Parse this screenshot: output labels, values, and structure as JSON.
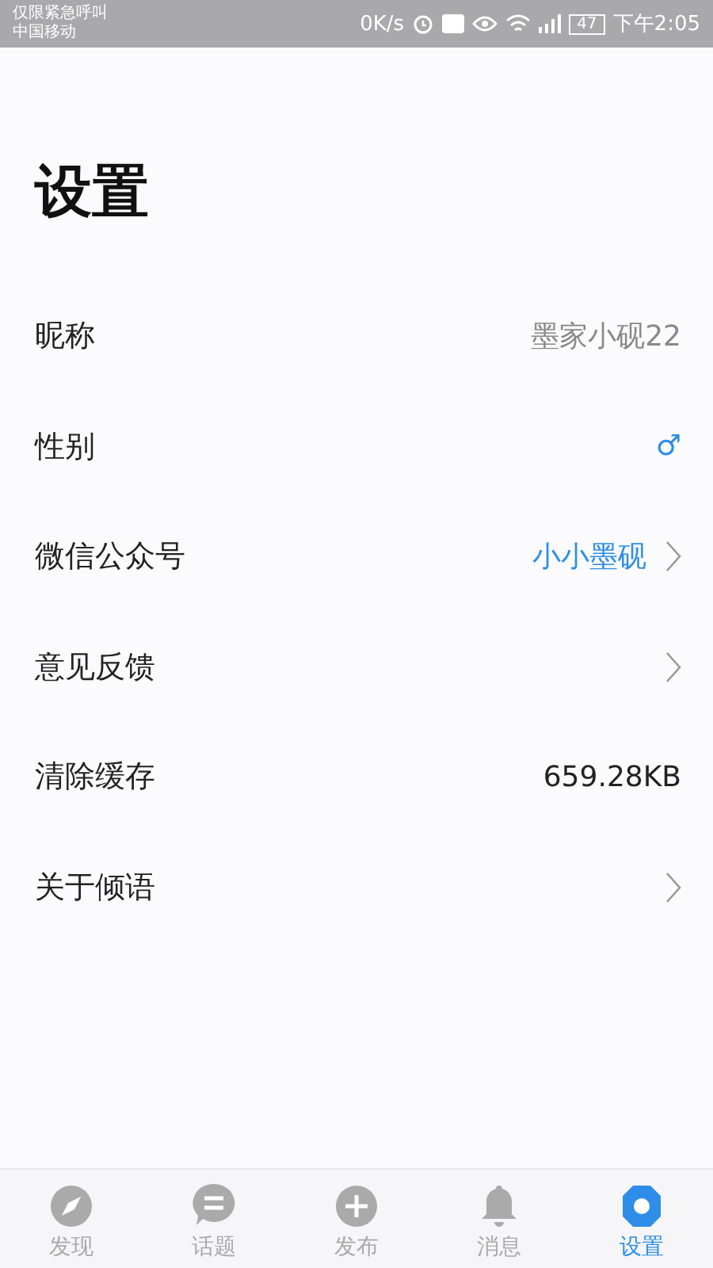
{
  "status_bar": {
    "carrier_line_1": "仅限紧急呼叫",
    "carrier_line_2": "中国移动",
    "speed": "0K/s",
    "battery": "47",
    "time": "下午2:05"
  },
  "title": "设置",
  "rows": [
    {
      "label": "昵称",
      "value": "墨家小砚22",
      "kind": "muted",
      "arrow": false
    },
    {
      "label": "性别",
      "value": "♂",
      "kind": "accent",
      "arrow": false
    },
    {
      "label": "微信公众号",
      "value": "小小墨砚",
      "kind": "accent",
      "arrow": true
    },
    {
      "label": "意见反馈",
      "arrow": true
    },
    {
      "label": "清除缓存",
      "value": "659.28KB",
      "kind": "plain",
      "arrow": false
    },
    {
      "label": "关于倾语",
      "arrow": true
    }
  ],
  "nav": [
    {
      "label": "发现",
      "selected": false
    },
    {
      "label": "话题",
      "selected": false
    },
    {
      "label": "发布",
      "selected": false
    },
    {
      "label": "消息",
      "selected": false
    },
    {
      "label": "设置",
      "selected": true
    }
  ]
}
